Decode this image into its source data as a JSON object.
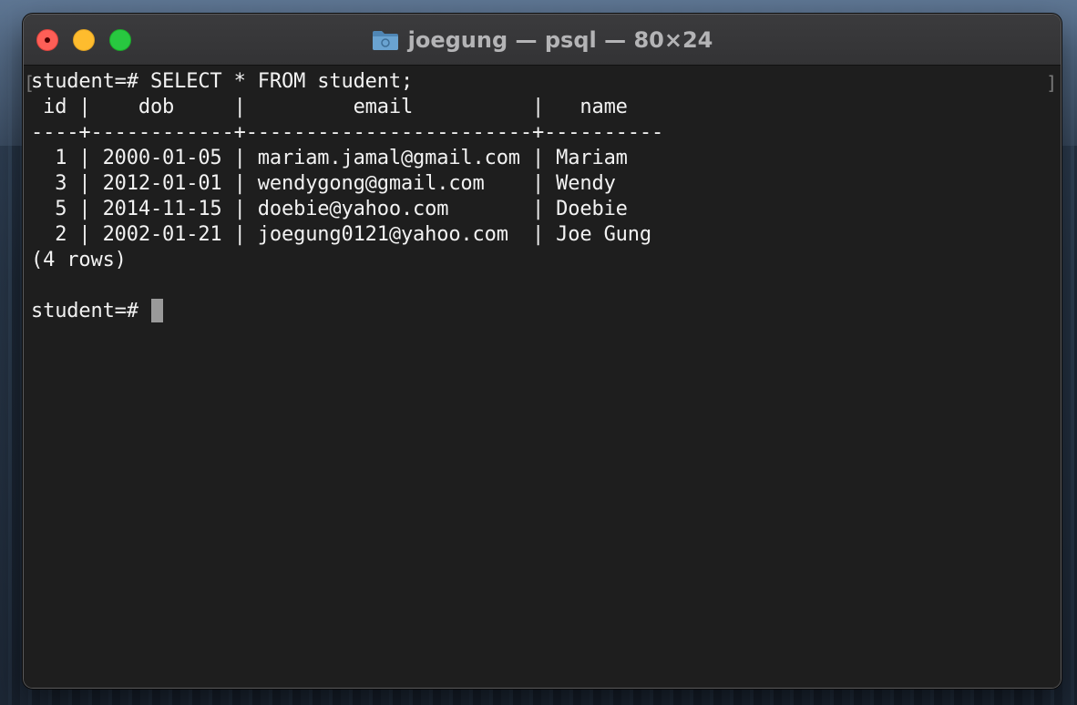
{
  "window": {
    "title": "joegung — psql — 80×24",
    "folder_icon": "folder-icon"
  },
  "terminal": {
    "bracket_left": "[",
    "bracket_right": "]",
    "lines": [
      "student=# SELECT * FROM student;",
      " id |    dob     |         email          |   name",
      "----+------------+------------------------+----------",
      "  1 | 2000-01-05 | mariam.jamal@gmail.com | Mariam",
      "  3 | 2012-01-01 | wendygong@gmail.com    | Wendy",
      "  5 | 2014-11-15 | doebie@yahoo.com       | Doebie",
      "  2 | 2002-01-21 | joegung0121@yahoo.com  | Joe Gung",
      "(4 rows)",
      ""
    ],
    "prompt": "student=# "
  },
  "colors": {
    "close": "#fe5f57",
    "minimize": "#febc2e",
    "maximize": "#28c840",
    "terminal_bg": "#1e1e1e",
    "terminal_fg": "#f2f2f2"
  }
}
